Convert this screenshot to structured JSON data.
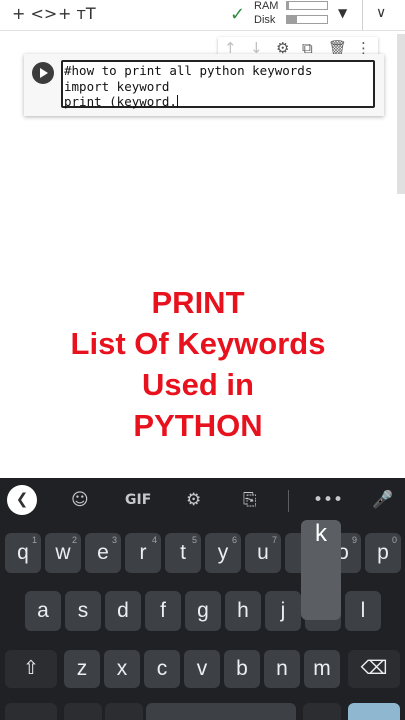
{
  "toolbar": {
    "add_code_label": "+ <>",
    "add_text_label": "+ ᴛT",
    "ram_label": "RAM",
    "disk_label": "Disk",
    "ram_usage": 0.05,
    "disk_usage": 0.25
  },
  "cell": {
    "code_lines": [
      "#how to print all python keywords",
      "import keyword",
      "print (keyword."
    ]
  },
  "overlay": {
    "lines": [
      "PRINT",
      "List Of Keywords",
      "Used in",
      "PYTHON"
    ],
    "color": "#e8121e"
  },
  "keyboard": {
    "gif_label": "GIF",
    "row1": [
      {
        "label": "q",
        "hint": "1"
      },
      {
        "label": "w",
        "hint": "2"
      },
      {
        "label": "e",
        "hint": "3"
      },
      {
        "label": "r",
        "hint": "4"
      },
      {
        "label": "t",
        "hint": "5"
      },
      {
        "label": "y",
        "hint": "6"
      },
      {
        "label": "u",
        "hint": "7"
      },
      {
        "label": "i",
        "hint": "8"
      },
      {
        "label": "o",
        "hint": "9"
      },
      {
        "label": "p",
        "hint": "0"
      }
    ],
    "row2": [
      "a",
      "s",
      "d",
      "f",
      "g",
      "h",
      "j",
      "k",
      "l"
    ],
    "row3": [
      "z",
      "x",
      "c",
      "v",
      "b",
      "n",
      "m"
    ],
    "popup_key": "k"
  }
}
